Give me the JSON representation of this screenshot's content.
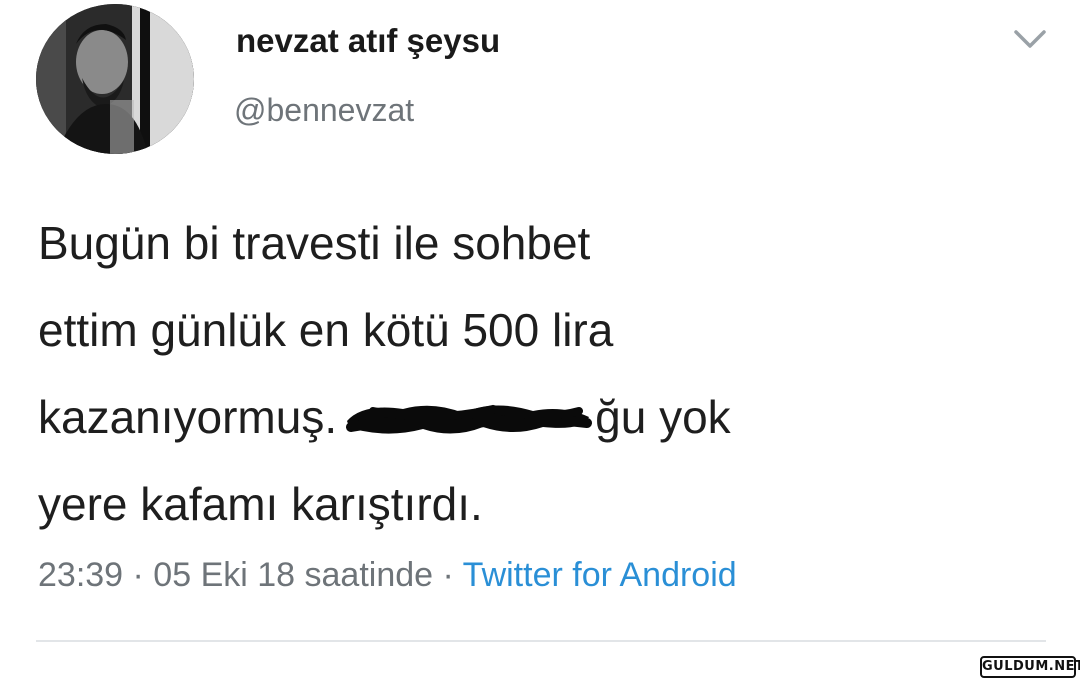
{
  "author": {
    "display_name": "nevzat atıf şeysu",
    "handle": "@bennevzat",
    "avatar_icon": "profile-photo-avatar"
  },
  "menu": {
    "icon": "chevron-down-icon"
  },
  "tweet": {
    "line1": "Bugün bi travesti ile sohbet",
    "line2": "ettim günlük en kötü 500 lira",
    "line3_before": "kazanıyormuş.",
    "line3_after": "ğu yok",
    "line4": "yere kafamı karıştırdı."
  },
  "meta": {
    "timestamp": "23:39 · 05 Eki 18 saatinde ·",
    "source": "Twitter for Android"
  },
  "watermark": {
    "text": "GULDUM.NET"
  },
  "colors": {
    "link": "#2a8fd6",
    "muted": "#6e7479",
    "text": "#1e1e1e",
    "background": "#ffffff"
  }
}
